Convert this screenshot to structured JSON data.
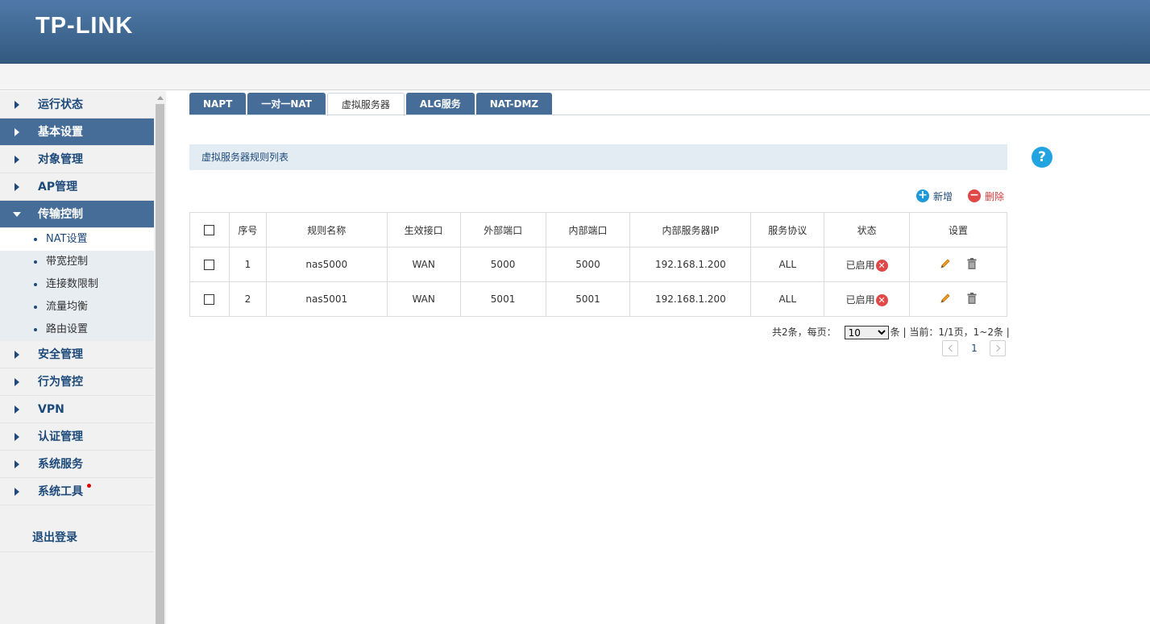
{
  "brand": {
    "logo": "TP-LINK"
  },
  "sidebar": {
    "items": [
      {
        "label": "运行状态"
      },
      {
        "label": "基本设置"
      },
      {
        "label": "对象管理"
      },
      {
        "label": "AP管理"
      },
      {
        "label": "传输控制"
      },
      {
        "label": "安全管理"
      },
      {
        "label": "行为管控"
      },
      {
        "label": "VPN"
      },
      {
        "label": "认证管理"
      },
      {
        "label": "系统服务"
      },
      {
        "label": "系统工具"
      }
    ],
    "submenu": [
      {
        "label": "NAT设置"
      },
      {
        "label": "带宽控制"
      },
      {
        "label": "连接数限制"
      },
      {
        "label": "流量均衡"
      },
      {
        "label": "路由设置"
      }
    ],
    "logout": "退出登录"
  },
  "tabs": [
    {
      "label": "NAPT"
    },
    {
      "label": "一对一NAT"
    },
    {
      "label": "虚拟服务器"
    },
    {
      "label": "ALG服务"
    },
    {
      "label": "NAT-DMZ"
    }
  ],
  "section": {
    "title": "虚拟服务器规则列表"
  },
  "help": {
    "label": "?"
  },
  "actions": {
    "add": "新增",
    "delete": "删除"
  },
  "table": {
    "headers": [
      "序号",
      "规则名称",
      "生效接口",
      "外部端口",
      "内部端口",
      "内部服务器IP",
      "服务协议",
      "状态",
      "设置"
    ],
    "rows": [
      {
        "index": "1",
        "name": "nas5000",
        "interface": "WAN",
        "ext_port": "5000",
        "int_port": "5000",
        "ip": "192.168.1.200",
        "protocol": "ALL",
        "status": "已启用"
      },
      {
        "index": "2",
        "name": "nas5001",
        "interface": "WAN",
        "ext_port": "5001",
        "int_port": "5001",
        "ip": "192.168.1.200",
        "protocol": "ALL",
        "status": "已启用"
      }
    ]
  },
  "pager": {
    "total_prefix": "共2条，每页：",
    "per_page": "10",
    "per_page_options": [
      "10"
    ],
    "suffix": "条 | 当前：1/1页，1~2条 |",
    "current_page": "1"
  },
  "colors": {
    "header": "#3f6791",
    "menu_active": "#466d97",
    "accent_blue": "#1e9ad8",
    "accent_red": "#e04848"
  }
}
